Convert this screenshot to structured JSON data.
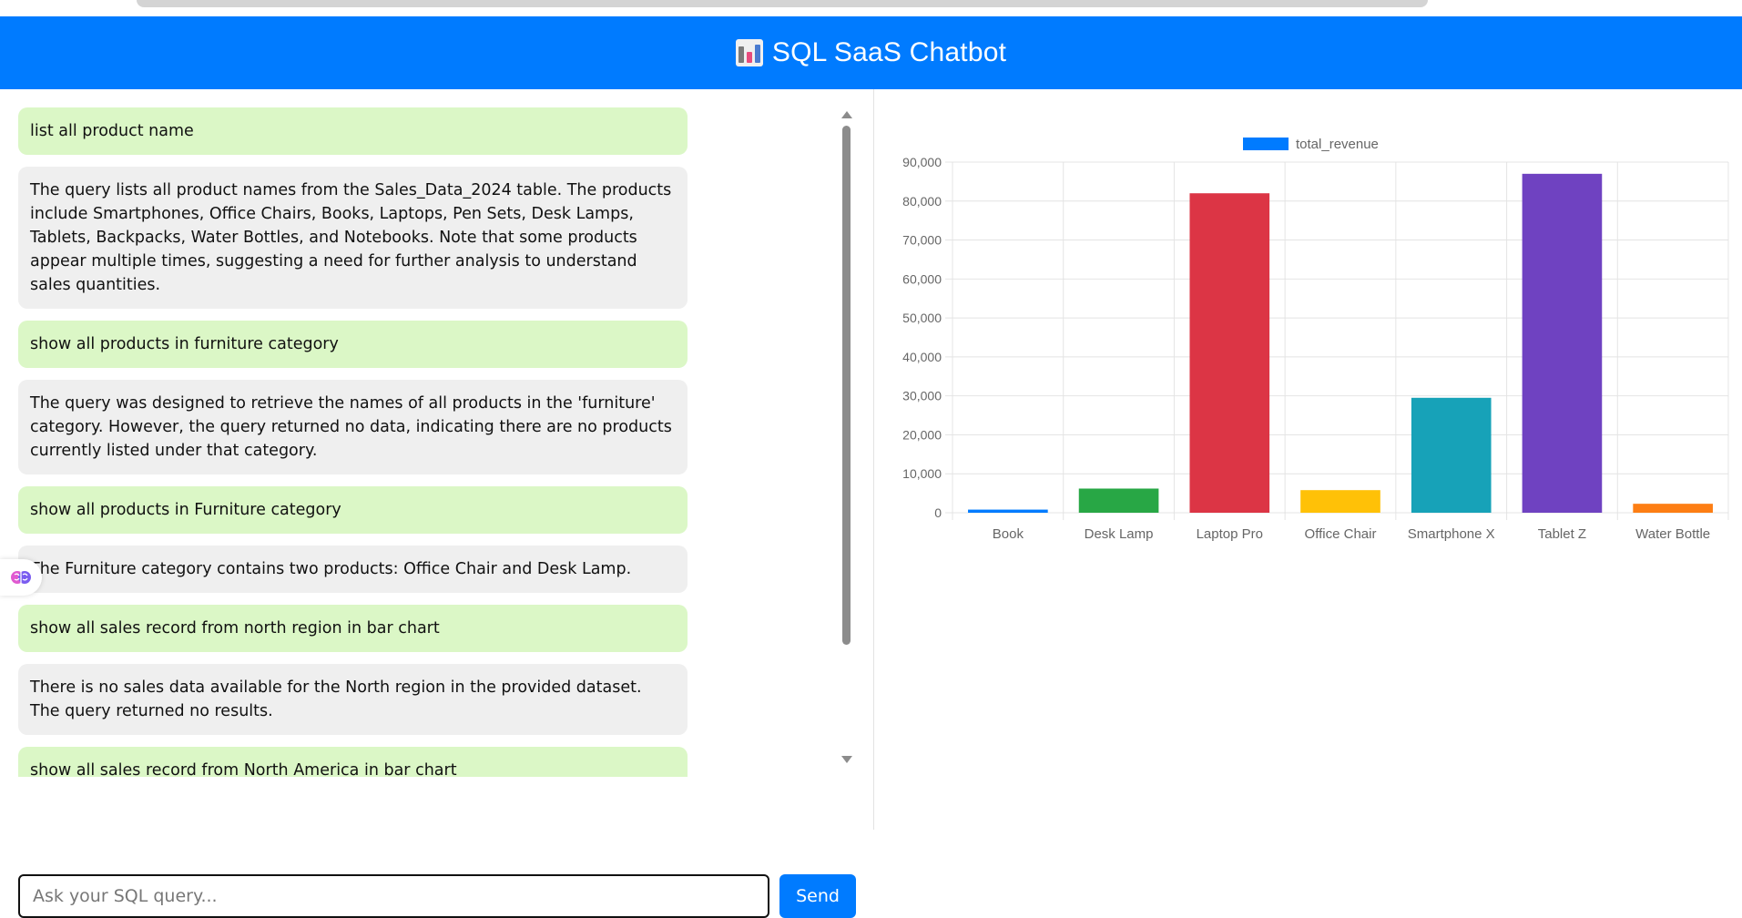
{
  "header": {
    "title": "SQL SaaS Chatbot"
  },
  "chat": {
    "messages": [
      {
        "role": "user",
        "text": "list all product name"
      },
      {
        "role": "bot",
        "text": "The query lists all product names from the Sales_Data_2024 table. The products include Smartphones, Office Chairs, Books, Laptops, Pen Sets, Desk Lamps, Tablets, Backpacks, Water Bottles, and Notebooks. Note that some products appear multiple times, suggesting a need for further analysis to understand sales quantities."
      },
      {
        "role": "user",
        "text": "show all products in furniture category"
      },
      {
        "role": "bot",
        "text": "The query was designed to retrieve the names of all products in the 'furniture' category. However, the query returned no data, indicating there are no products currently listed under that category."
      },
      {
        "role": "user",
        "text": "show all products in Furniture category"
      },
      {
        "role": "bot",
        "text": "The Furniture category contains two products: Office Chair and Desk Lamp."
      },
      {
        "role": "user",
        "text": "show all sales record from north region in bar chart"
      },
      {
        "role": "bot",
        "text": "There is no sales data available for the North region in the provided dataset. The query returned no results."
      },
      {
        "role": "user",
        "text": "show all sales record from North America in bar chart"
      }
    ]
  },
  "input": {
    "placeholder": "Ask your SQL query...",
    "send_label": "Send"
  },
  "colors": {
    "header": "#007bff",
    "user_bubble": "#dbf7c6",
    "bot_bubble": "#efefef"
  },
  "icons": {
    "logo": "bar-chart-icon",
    "side": "brain-icon"
  },
  "chart_data": {
    "type": "bar",
    "categories": [
      "Book",
      "Desk Lamp",
      "Laptop Pro",
      "Office Chair",
      "Smartphone X",
      "Tablet Z",
      "Water Bottle"
    ],
    "series": [
      {
        "name": "total_revenue",
        "values": [
          800,
          6200,
          82000,
          5800,
          29500,
          87000,
          2300
        ]
      }
    ],
    "bar_colors": [
      "#007bff",
      "#28a745",
      "#dc3545",
      "#ffc107",
      "#17a2b8",
      "#6f42c1",
      "#fd7e14"
    ],
    "legend_color": "#007bff",
    "ylim": [
      0,
      90000
    ],
    "yticks": [
      "0",
      "10,000",
      "20,000",
      "30,000",
      "40,000",
      "50,000",
      "60,000",
      "70,000",
      "80,000",
      "90,000"
    ],
    "grid": true,
    "legend": "top-center"
  }
}
